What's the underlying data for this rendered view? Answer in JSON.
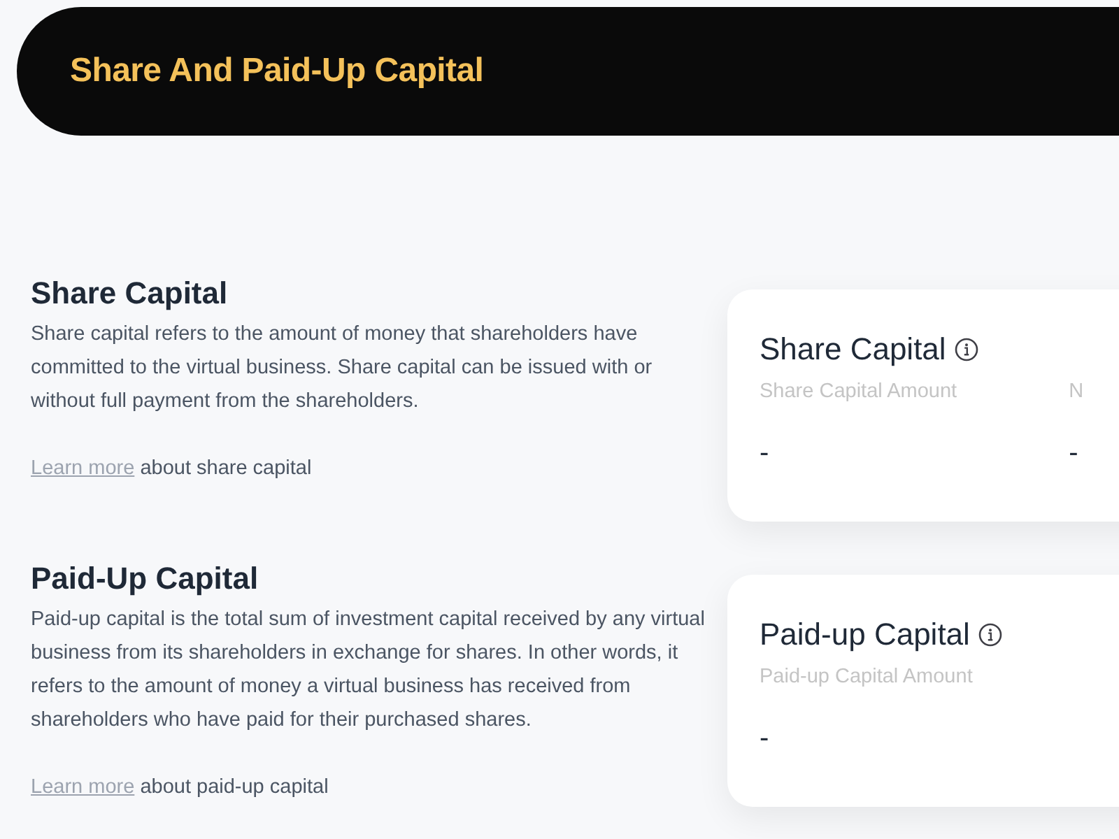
{
  "header": {
    "title": "Share And Paid-Up Capital"
  },
  "sections": [
    {
      "heading": "Share Capital",
      "description": "Share capital refers to the amount of money that shareholders have committed to the virtual business. Share capital can be issued with or without full payment from the shareholders.",
      "link": "Learn more",
      "link_suffix": "about share capital",
      "card": {
        "title": "Share Capital",
        "fields": [
          {
            "label": "Share Capital Amount",
            "value": "-"
          },
          {
            "label": "N",
            "value": "-"
          }
        ]
      }
    },
    {
      "heading": "Paid-Up Capital",
      "description": "Paid-up capital is the total sum of investment capital received by any virtual business from its shareholders in exchange for shares. In other words, it refers to the amount of money a virtual business has received from shareholders who have paid for their purchased shares.",
      "link": "Learn more",
      "link_suffix": "about paid-up capital",
      "card": {
        "title": "Paid-up Capital",
        "fields": [
          {
            "label": "Paid-up Capital Amount",
            "value": "-"
          }
        ]
      }
    }
  ]
}
